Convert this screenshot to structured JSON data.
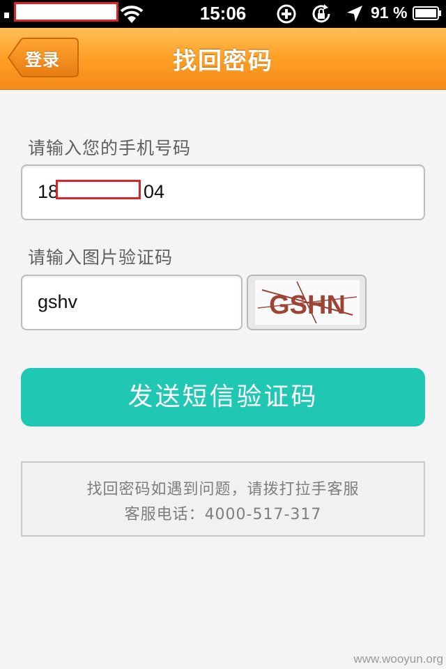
{
  "status_bar": {
    "time": "15:06",
    "battery_percent": "91 %"
  },
  "nav": {
    "back_label": "登录",
    "title": "找回密码"
  },
  "phone_section": {
    "label": "请输入您的手机号码",
    "value_prefix": "18",
    "value_suffix": "04"
  },
  "captcha_section": {
    "label": "请输入图片验证码",
    "value": "gshv",
    "captcha_image_text": "GSHN"
  },
  "send_button": {
    "label": "发送短信验证码"
  },
  "help": {
    "line1": "找回密码如遇到问题，请拨打拉手客服",
    "line2": "客服电话：4000-517-317"
  },
  "watermark": "www.wooyun.org",
  "colors": {
    "nav_orange": "#ff9f25",
    "button_teal": "#20c7b3",
    "redaction_red": "#d6252b"
  }
}
